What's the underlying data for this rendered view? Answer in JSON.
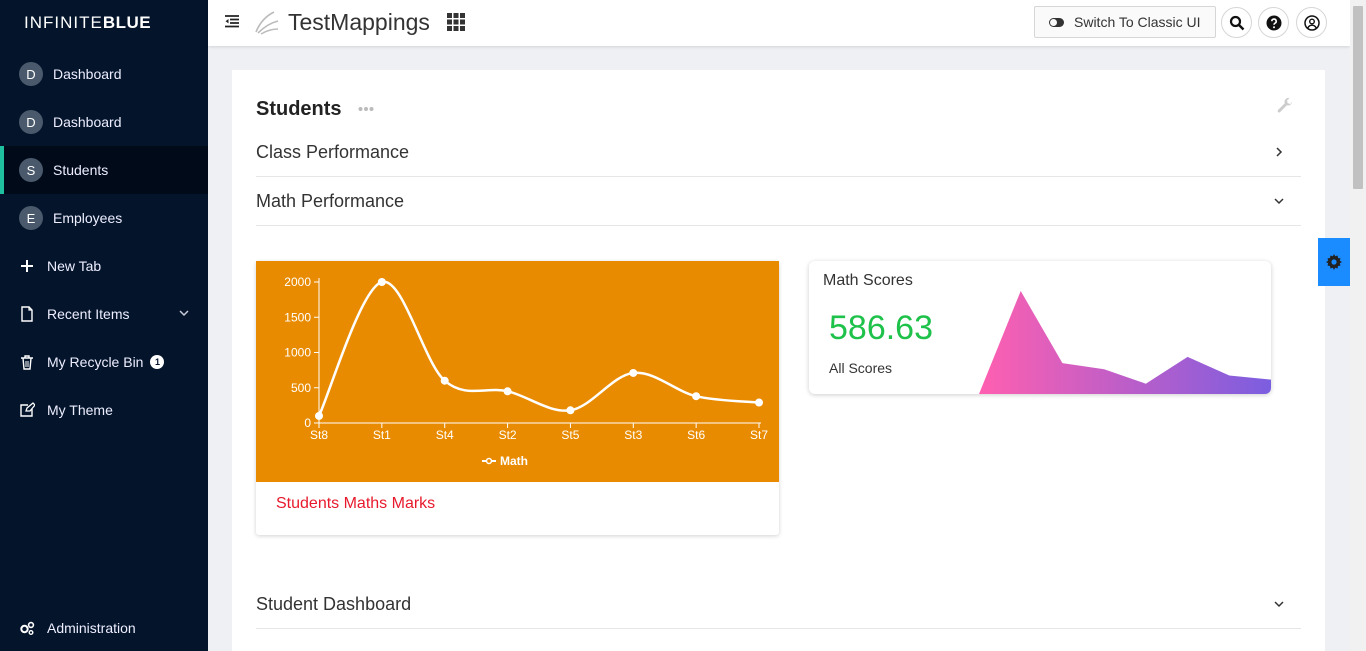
{
  "brand": {
    "light": "INFINITE",
    "bold": "BLUE"
  },
  "sidebar": {
    "items": [
      {
        "avatar": "D",
        "label": "Dashboard"
      },
      {
        "avatar": "D",
        "label": "Dashboard"
      },
      {
        "avatar": "S",
        "label": "Students"
      },
      {
        "avatar": "E",
        "label": "Employees"
      },
      {
        "label": "New Tab"
      },
      {
        "label": "Recent Items"
      },
      {
        "label": "My Recycle Bin",
        "badge": "1"
      },
      {
        "label": "My Theme"
      }
    ],
    "admin_label": "Administration"
  },
  "topbar": {
    "app_title": "TestMappings",
    "classic_label": "Switch To Classic UI"
  },
  "page": {
    "title": "Students",
    "sections": [
      "Class Performance",
      "Math Performance",
      "Student Dashboard"
    ]
  },
  "chart_data": {
    "type": "line",
    "categories": [
      "St8",
      "St1",
      "St4",
      "St2",
      "St5",
      "St3",
      "St6",
      "St7"
    ],
    "series": [
      {
        "name": "Math",
        "values": [
          100,
          2000,
          600,
          450,
          180,
          710,
          380,
          290
        ]
      }
    ],
    "ylim": [
      0,
      2000
    ],
    "yticks": [
      0,
      500,
      1000,
      1500,
      2000
    ],
    "legend": "bottom",
    "caption": "Students Maths Marks"
  },
  "score_card": {
    "title": "Math Scores",
    "value": "586.63",
    "subtitle": "All Scores",
    "spark_values": [
      0,
      100,
      30,
      24,
      10,
      36,
      18,
      14
    ]
  },
  "colors": {
    "sidebar_bg": "#03142b",
    "active_accent": "#1fc0a0",
    "chart_bg": "#e98b00",
    "caption_red": "#e8192c",
    "score_green": "#1ec24a",
    "spark_start": "#ff5fb0",
    "spark_end": "#7b5ee0",
    "settings_blue": "#1a8cff"
  }
}
